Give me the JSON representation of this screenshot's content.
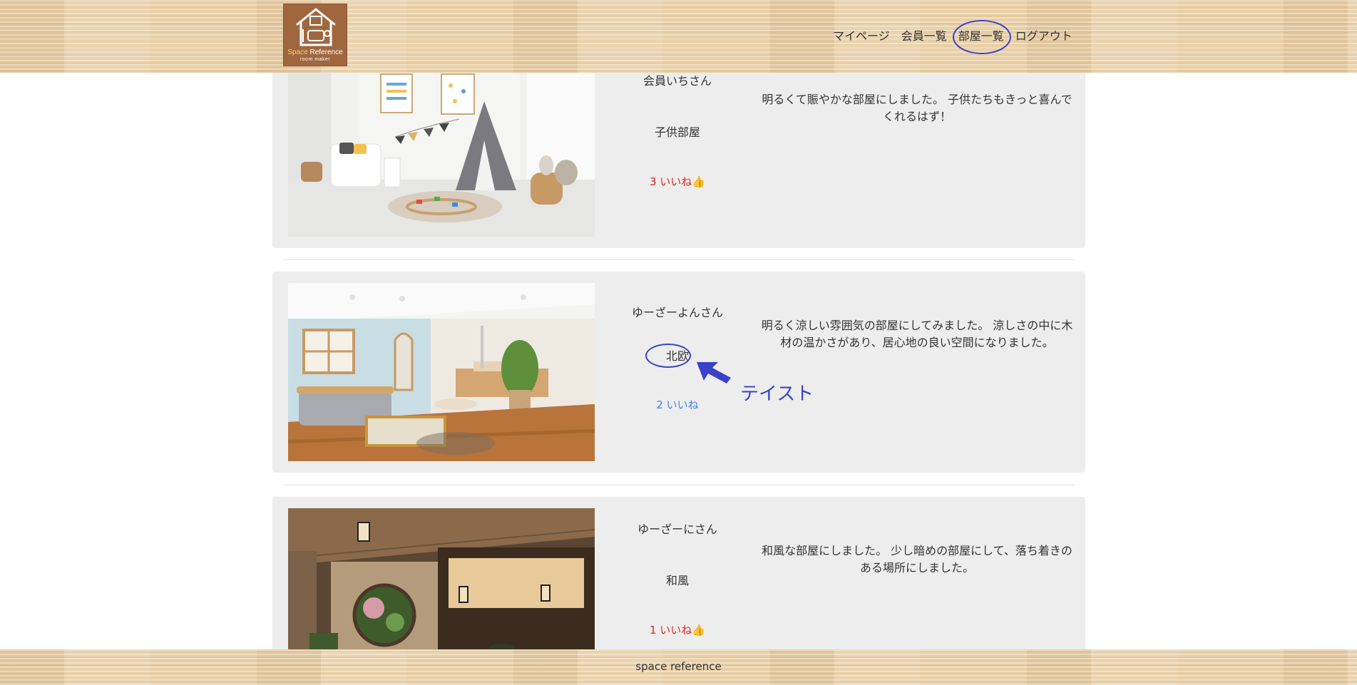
{
  "header": {
    "logo": {
      "title_a": "Space",
      "title_b": "Reference",
      "subtitle": "room maker"
    },
    "nav": [
      "マイページ",
      "会員一覧",
      "部屋一覧",
      "ログアウト"
    ]
  },
  "rooms": [
    {
      "user": "会員いちさん",
      "taste": "子供部屋",
      "likes": "3 いいね",
      "like_icon": "thumbs-up-icon",
      "liked": true,
      "description": "明るくて賑やかな部屋にしました。 子供たちもきっと喜んでくれるはず！"
    },
    {
      "user": "ゆーざーよんさん",
      "taste": "北欧",
      "likes": "2 いいね",
      "liked": false,
      "description": "明るく涼しい雰囲気の部屋にしてみました。 涼しさの中に木材の温かさがあり、居心地の良い空間になりました。"
    },
    {
      "user": "ゆーざーにさん",
      "taste": "和風",
      "likes": "1 いいね",
      "like_icon": "thumbs-up-icon",
      "liked": true,
      "description": "和風な部屋にしました。 少し暗めの部屋にして、落ち着きのある場所にしました。"
    }
  ],
  "annotation": {
    "label": "テイスト"
  },
  "footer": {
    "text": "space reference"
  },
  "colors": {
    "annotation": "#3a41c9",
    "liked": "#e0241f",
    "unliked": "#3f85ea",
    "card_bg": "#ededed"
  }
}
